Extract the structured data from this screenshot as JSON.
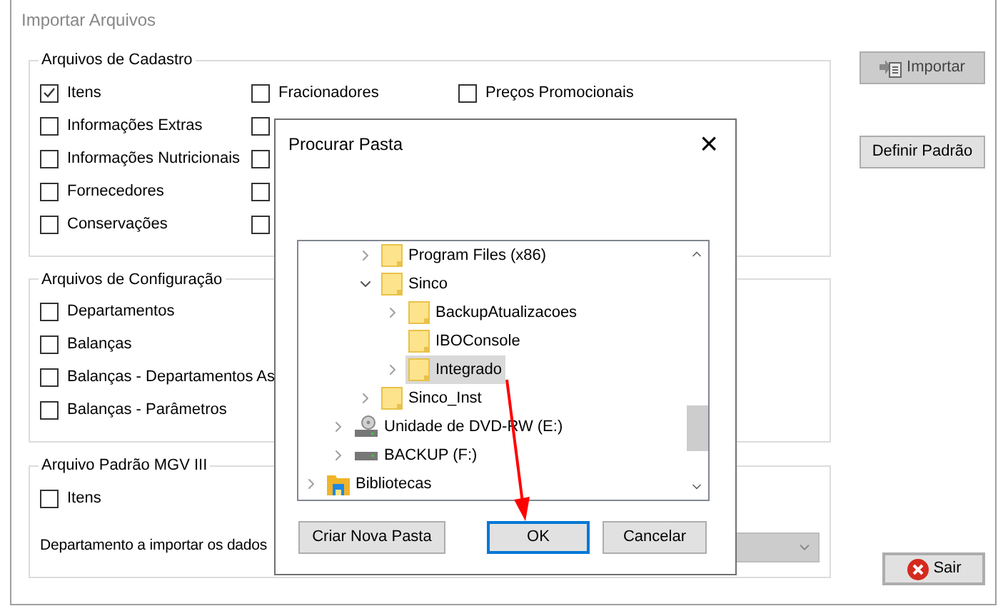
{
  "window": {
    "title": "Importar Arquivos"
  },
  "groups": [
    {
      "title": "Arquivos de Cadastro",
      "columns": [
        [
          {
            "label": "Itens",
            "checked": true
          },
          {
            "label": "Informações Extras",
            "checked": false
          },
          {
            "label": "Informações Nutricionais",
            "checked": false
          },
          {
            "label": "Fornecedores",
            "checked": false
          },
          {
            "label": "Conservações",
            "checked": false
          }
        ],
        [
          {
            "label": "Fracionadores",
            "checked": false
          },
          {
            "checked": false
          },
          {
            "checked": false
          },
          {
            "checked": false
          },
          {
            "checked": false
          }
        ],
        [
          {
            "label": "Preços Promocionais",
            "checked": false
          }
        ]
      ]
    },
    {
      "title": "Arquivos de Configuração",
      "columns": [
        [
          {
            "label": "Departamentos",
            "checked": false
          },
          {
            "label": "Balanças",
            "checked": false
          },
          {
            "label": "Balanças - Departamentos As",
            "checked": false
          },
          {
            "label": "Balanças - Parâmetros",
            "checked": false
          }
        ]
      ]
    },
    {
      "title": "Arquivo Padrão MGV III",
      "columns": [
        [
          {
            "label": "Itens",
            "checked": false
          }
        ]
      ],
      "dropdown": {
        "label": "Departamento a importar os dados",
        "disabled": true
      }
    }
  ],
  "side_buttons": [
    {
      "label": "Importar",
      "kind": "import",
      "disabled": true,
      "focused": false
    },
    {
      "label": "Definir Padrão",
      "kind": "plain",
      "disabled": false,
      "focused": false
    },
    {
      "label": "Sair",
      "kind": "exit",
      "disabled": false,
      "focused": true
    }
  ],
  "dialog": {
    "title": "Procurar Pasta",
    "close": "×",
    "tree": [
      {
        "children": [
          {
            "children": [
              {
                "label": "Program Files (x86)",
                "kind": "folder",
                "expandable": true,
                "expanded": false,
                "selected": false
              },
              {
                "label": "Sinco",
                "kind": "folder",
                "expandable": true,
                "expanded": true,
                "selected": false,
                "children": [
                  {
                    "label": "BackupAtualizacoes",
                    "kind": "folder",
                    "expandable": true,
                    "expanded": false,
                    "selected": false
                  },
                  {
                    "label": "IBOConsole",
                    "kind": "folder",
                    "expandable": false,
                    "selected": false
                  },
                  {
                    "label": "Integrado",
                    "kind": "folder",
                    "expandable": true,
                    "expanded": false,
                    "selected": true
                  }
                ]
              },
              {
                "label": "Sinco_Inst",
                "kind": "folder",
                "expandable": true,
                "expanded": false,
                "selected": false
              }
            ]
          },
          {
            "label": "Unidade de DVD-RW (E:)",
            "kind": "dvd",
            "expandable": true,
            "expanded": false,
            "selected": false
          },
          {
            "label": "BACKUP (F:)",
            "kind": "drive",
            "expandable": true,
            "expanded": false,
            "selected": false
          }
        ]
      },
      {
        "label": "Bibliotecas",
        "kind": "library",
        "expandable": true,
        "expanded": false,
        "selected": false
      }
    ],
    "buttons": [
      {
        "label": "Criar Nova Pasta",
        "focused": false
      },
      {
        "label": "OK",
        "focused": true
      },
      {
        "label": "Cancelar",
        "focused": false
      }
    ]
  }
}
